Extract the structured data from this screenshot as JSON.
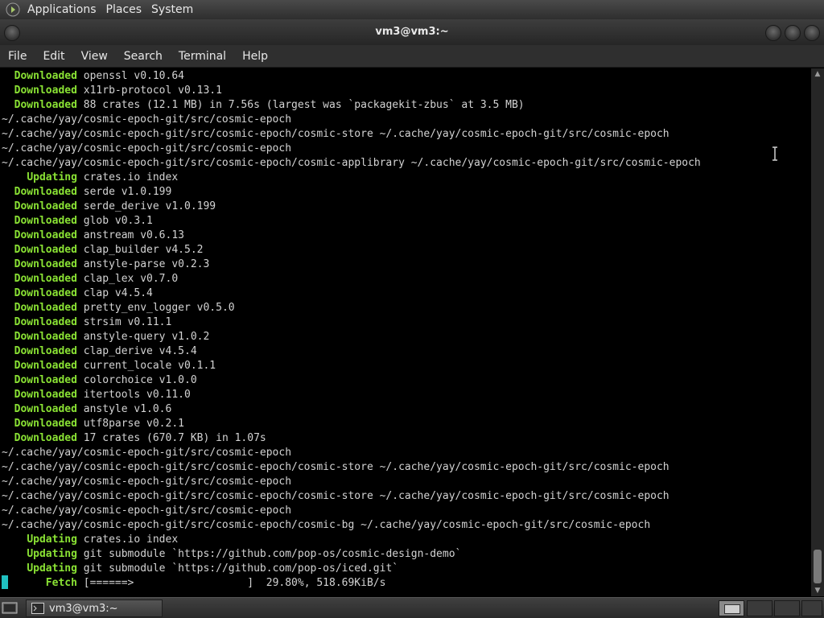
{
  "top_panel": {
    "menus": [
      "Applications",
      "Places",
      "System"
    ]
  },
  "window": {
    "title": "vm3@vm3:~"
  },
  "menubar": {
    "items": [
      "File",
      "Edit",
      "View",
      "Search",
      "Terminal",
      "Help"
    ]
  },
  "terminal": {
    "lines": [
      {
        "kw": "Downloaded",
        "rest": "openssl v0.10.64",
        "indent": 2
      },
      {
        "kw": "Downloaded",
        "rest": "x11rb-protocol v0.13.1",
        "indent": 2
      },
      {
        "kw": "Downloaded",
        "rest": "88 crates (12.1 MB) in 7.56s (largest was `packagekit-zbus` at 3.5 MB)",
        "indent": 2
      },
      {
        "kw": "",
        "rest": "~/.cache/yay/cosmic-epoch-git/src/cosmic-epoch",
        "indent": 0
      },
      {
        "kw": "",
        "rest": "~/.cache/yay/cosmic-epoch-git/src/cosmic-epoch/cosmic-store ~/.cache/yay/cosmic-epoch-git/src/cosmic-epoch",
        "indent": 0
      },
      {
        "kw": "",
        "rest": "~/.cache/yay/cosmic-epoch-git/src/cosmic-epoch",
        "indent": 0
      },
      {
        "kw": "",
        "rest": "~/.cache/yay/cosmic-epoch-git/src/cosmic-epoch/cosmic-applibrary ~/.cache/yay/cosmic-epoch-git/src/cosmic-epoch",
        "indent": 0
      },
      {
        "kw": "Updating",
        "rest": "crates.io index",
        "indent": 4
      },
      {
        "kw": "Downloaded",
        "rest": "serde v1.0.199",
        "indent": 2
      },
      {
        "kw": "Downloaded",
        "rest": "serde_derive v1.0.199",
        "indent": 2
      },
      {
        "kw": "Downloaded",
        "rest": "glob v0.3.1",
        "indent": 2
      },
      {
        "kw": "Downloaded",
        "rest": "anstream v0.6.13",
        "indent": 2
      },
      {
        "kw": "Downloaded",
        "rest": "clap_builder v4.5.2",
        "indent": 2
      },
      {
        "kw": "Downloaded",
        "rest": "anstyle-parse v0.2.3",
        "indent": 2
      },
      {
        "kw": "Downloaded",
        "rest": "clap_lex v0.7.0",
        "indent": 2
      },
      {
        "kw": "Downloaded",
        "rest": "clap v4.5.4",
        "indent": 2
      },
      {
        "kw": "Downloaded",
        "rest": "pretty_env_logger v0.5.0",
        "indent": 2
      },
      {
        "kw": "Downloaded",
        "rest": "strsim v0.11.1",
        "indent": 2
      },
      {
        "kw": "Downloaded",
        "rest": "anstyle-query v1.0.2",
        "indent": 2
      },
      {
        "kw": "Downloaded",
        "rest": "clap_derive v4.5.4",
        "indent": 2
      },
      {
        "kw": "Downloaded",
        "rest": "current_locale v0.1.1",
        "indent": 2
      },
      {
        "kw": "Downloaded",
        "rest": "colorchoice v1.0.0",
        "indent": 2
      },
      {
        "kw": "Downloaded",
        "rest": "itertools v0.11.0",
        "indent": 2
      },
      {
        "kw": "Downloaded",
        "rest": "anstyle v1.0.6",
        "indent": 2
      },
      {
        "kw": "Downloaded",
        "rest": "utf8parse v0.2.1",
        "indent": 2
      },
      {
        "kw": "Downloaded",
        "rest": "17 crates (670.7 KB) in 1.07s",
        "indent": 2
      },
      {
        "kw": "",
        "rest": "~/.cache/yay/cosmic-epoch-git/src/cosmic-epoch",
        "indent": 0
      },
      {
        "kw": "",
        "rest": "~/.cache/yay/cosmic-epoch-git/src/cosmic-epoch/cosmic-store ~/.cache/yay/cosmic-epoch-git/src/cosmic-epoch",
        "indent": 0
      },
      {
        "kw": "",
        "rest": "~/.cache/yay/cosmic-epoch-git/src/cosmic-epoch",
        "indent": 0
      },
      {
        "kw": "",
        "rest": "~/.cache/yay/cosmic-epoch-git/src/cosmic-epoch/cosmic-store ~/.cache/yay/cosmic-epoch-git/src/cosmic-epoch",
        "indent": 0
      },
      {
        "kw": "",
        "rest": "~/.cache/yay/cosmic-epoch-git/src/cosmic-epoch",
        "indent": 0
      },
      {
        "kw": "",
        "rest": "~/.cache/yay/cosmic-epoch-git/src/cosmic-epoch/cosmic-bg ~/.cache/yay/cosmic-epoch-git/src/cosmic-epoch",
        "indent": 0
      },
      {
        "kw": "Updating",
        "rest": "crates.io index",
        "indent": 4
      },
      {
        "kw": "Updating",
        "rest": "git submodule `https://github.com/pop-os/cosmic-design-demo`",
        "indent": 4
      },
      {
        "kw": "Updating",
        "rest": "git submodule `https://github.com/pop-os/iced.git`",
        "indent": 4
      },
      {
        "kw": "Fetch",
        "rest": "[======>                  ]  29.80%, 518.69KiB/s",
        "indent": 7
      }
    ],
    "fetch_progress_percent": 29.8,
    "colors": {
      "text": "#d3d3d3",
      "keyword": "#8ae234",
      "cursor": "#20c0c0",
      "background": "#000000"
    }
  },
  "taskbar": {
    "task_label": "vm3@vm3:~",
    "workspaces": 4,
    "active_workspace": 1
  }
}
